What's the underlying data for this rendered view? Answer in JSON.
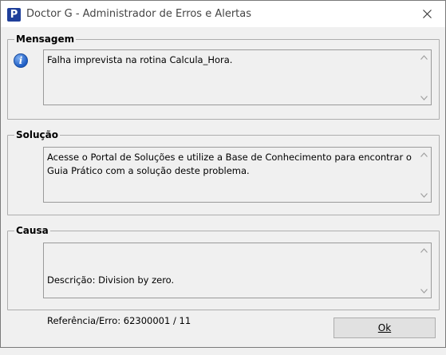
{
  "window": {
    "title": "Doctor G - Administrador de Erros e Alertas",
    "app_icon_letter": "P",
    "close_glyph": "✕"
  },
  "mensagem": {
    "label": "Mensagem",
    "text": "Falha imprevista na rotina Calcula_Hora."
  },
  "solucao": {
    "label": "Solução",
    "text": "Acesse o Portal de Soluções e utilize a Base de Conhecimento para encontrar o Guia Prático com a solução deste problema."
  },
  "causa": {
    "label": "Causa",
    "line1": "Descrição: Division by zero.",
    "line2": "Referência/Erro: 62300001 / 11"
  },
  "ok_button": {
    "label": "Ok"
  },
  "icons": {
    "info": "info-icon",
    "scroll_up": "chevron-up-icon",
    "scroll_down": "chevron-down-icon"
  }
}
